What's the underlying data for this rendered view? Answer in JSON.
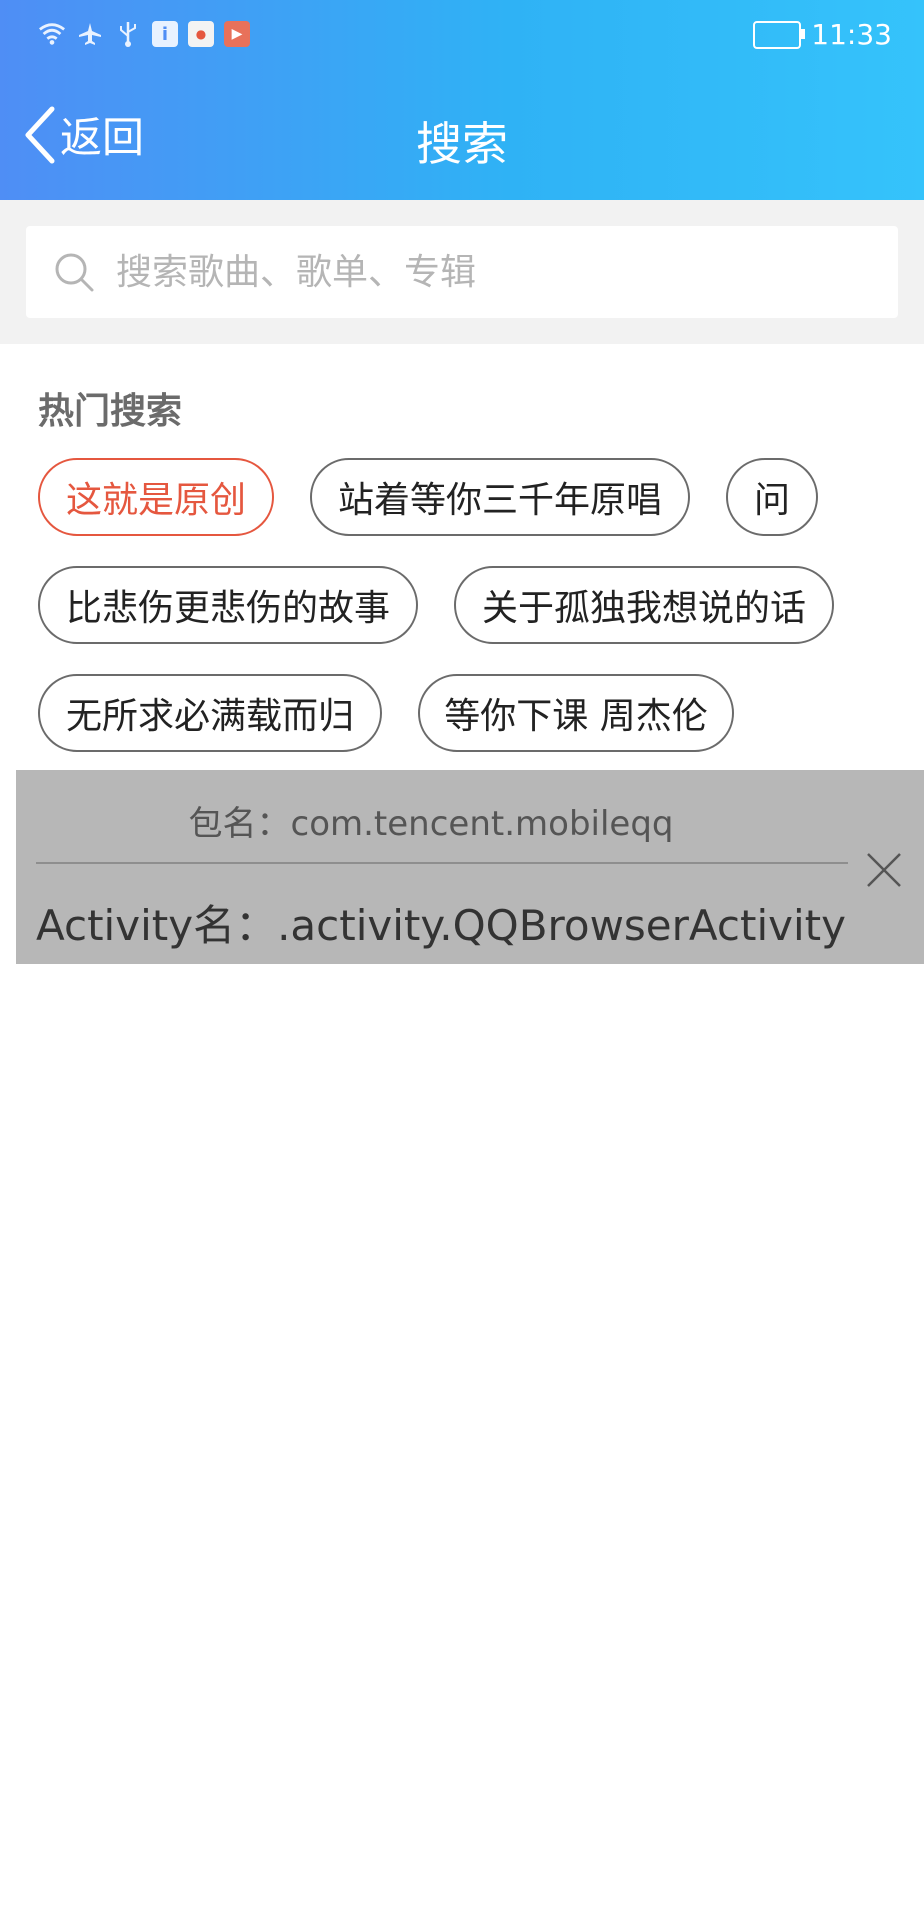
{
  "status_bar": {
    "time": "11:33",
    "left_icons": [
      "wifi-icon",
      "airplane-icon",
      "usb-icon",
      "info-app-icon",
      "app-icon",
      "video-app-icon"
    ]
  },
  "header": {
    "back_label": "返回",
    "title": "搜索",
    "gradient": [
      "#4f8ef5",
      "#35c3fb"
    ]
  },
  "search": {
    "placeholder": "搜索歌曲、歌单、专辑",
    "value": ""
  },
  "hot": {
    "title": "热门搜索",
    "tags": [
      "这就是原创",
      "站着等你三千年原唱",
      "问",
      "比悲伤更悲伤的故事",
      "关于孤独我想说的话",
      "无所求必满载而归",
      "等你下课 周杰伦"
    ],
    "active_color": "#e5573f"
  },
  "debug_overlay": {
    "package_line": "包名：com.tencent.mobileqq",
    "activity_line": "Activity名：.activity.QQBrowserActivity"
  }
}
